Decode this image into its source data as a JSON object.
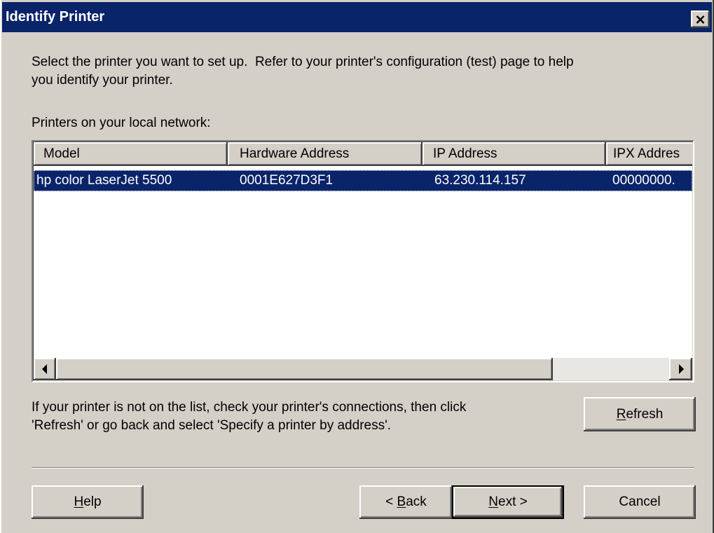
{
  "colors": {
    "accent": "#0a246a",
    "face": "#d4d0c8",
    "selection": "#0a246a"
  },
  "icons": {
    "close": "close-icon",
    "scroll_left": "left-arrow-icon",
    "scroll_right": "right-arrow-icon"
  },
  "window": {
    "title": "Identify Printer"
  },
  "intro": {
    "line1": "Select the printer you want to set up.  Refer to your printer's configuration (test) page to help",
    "line2": "you identify your printer."
  },
  "list_label": "Printers on your local network:",
  "printer_list": {
    "columns": [
      "Model",
      "Hardware Address",
      "IP Address",
      "IPX Addres"
    ],
    "rows": [
      {
        "model": "hp color LaserJet 5500",
        "hardware_address": "0001E627D3F1",
        "ip_address": "63.230.114.157",
        "ipx_address": "00000000.",
        "selected": true
      }
    ],
    "horizontal_scroll": {
      "position": 0,
      "visible_fraction": 0.81
    }
  },
  "hint": {
    "line1": "If your printer is not on the list, check your printer's connections, then click",
    "line2": "'Refresh' or go back and select 'Specify a printer by address'."
  },
  "buttons": {
    "refresh": {
      "label": "Refresh",
      "mnemonic": "R"
    },
    "help": {
      "label": "Help",
      "mnemonic": "H"
    },
    "back": {
      "label": "< Back",
      "mnemonic": "B"
    },
    "next": {
      "label": "Next >",
      "mnemonic": "N",
      "default": true
    },
    "cancel": {
      "label": "Cancel"
    }
  }
}
